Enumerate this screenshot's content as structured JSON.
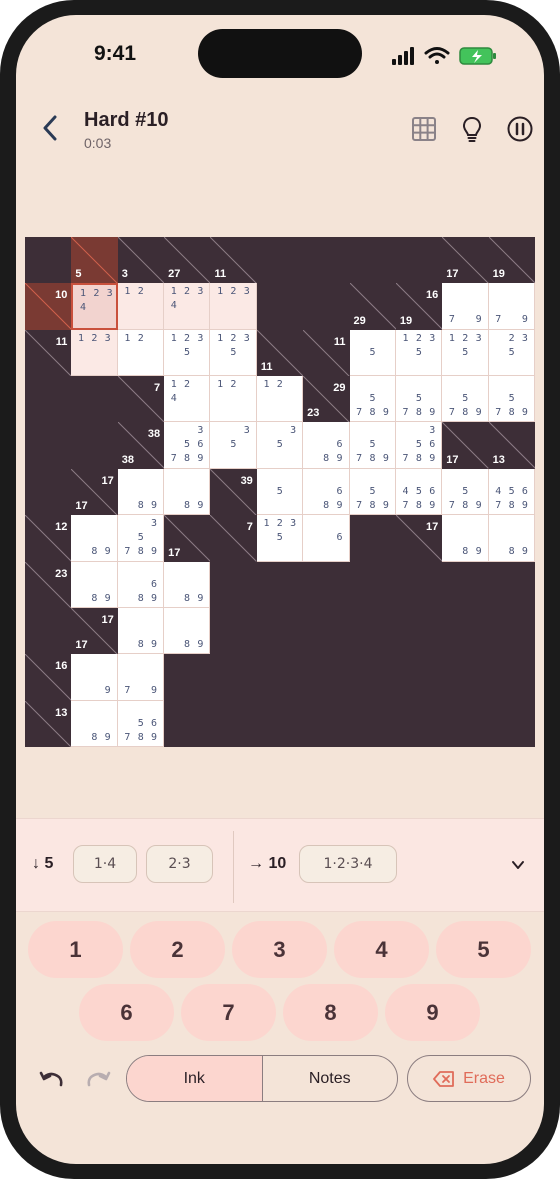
{
  "status": {
    "time": "9:41"
  },
  "header": {
    "title": "Hard #10",
    "timer": "0:03"
  },
  "icons": {
    "back": "chevron-left-icon",
    "grid": "grid-icon",
    "hint": "lightbulb-icon",
    "pause": "pause-icon",
    "undo": "undo-icon",
    "redo": "redo-icon",
    "erase": "erase-icon",
    "expand": "chevron-down-icon"
  },
  "colors": {
    "board": "#3d2e37",
    "cell": "#ffffff",
    "selected_border": "#c9503c",
    "accent": "#fcd6cf",
    "note": "#4a5577"
  },
  "board": {
    "rows": 11,
    "cols": 11,
    "cells": [
      {
        "r": 0,
        "c": 1,
        "down": "5",
        "hl": true
      },
      {
        "r": 0,
        "c": 2,
        "down": "3"
      },
      {
        "r": 0,
        "c": 3,
        "down": "27"
      },
      {
        "r": 0,
        "c": 4,
        "down": "11"
      },
      {
        "r": 0,
        "c": 9,
        "down": "17"
      },
      {
        "r": 0,
        "c": 10,
        "down": "19"
      },
      {
        "r": 1,
        "c": 0,
        "right": "10",
        "hl": true
      },
      {
        "r": 1,
        "c": 1,
        "notes": [
          "1",
          "2",
          "3",
          "4",
          "",
          "",
          "",
          "",
          ""
        ],
        "state": "sel"
      },
      {
        "r": 1,
        "c": 2,
        "notes": [
          "1",
          "2",
          "",
          "",
          "",
          "",
          "",
          "",
          ""
        ],
        "state": "hl"
      },
      {
        "r": 1,
        "c": 3,
        "notes": [
          "1",
          "2",
          "3",
          "4",
          "",
          "",
          "",
          "",
          ""
        ],
        "state": "hl"
      },
      {
        "r": 1,
        "c": 4,
        "notes": [
          "1",
          "2",
          "3",
          "",
          "",
          "",
          "",
          "",
          ""
        ],
        "state": "hl"
      },
      {
        "r": 1,
        "c": 7,
        "down": "29"
      },
      {
        "r": 1,
        "c": 8,
        "down": "19"
      },
      {
        "r": 1,
        "c": 8,
        "right": "16"
      },
      {
        "r": 1,
        "c": 9,
        "notes": [
          "",
          "",
          "",
          "",
          "",
          "",
          "7",
          "",
          "9"
        ]
      },
      {
        "r": 1,
        "c": 10,
        "notes": [
          "",
          "",
          "",
          "",
          "",
          "",
          "7",
          "",
          "9"
        ]
      },
      {
        "r": 2,
        "c": 0,
        "right": "11"
      },
      {
        "r": 2,
        "c": 1,
        "notes": [
          "1",
          "2",
          "3",
          "",
          "",
          "",
          "",
          "",
          ""
        ],
        "state": "hl"
      },
      {
        "r": 2,
        "c": 2,
        "notes": [
          "1",
          "2",
          "",
          "",
          "",
          "",
          "",
          "",
          ""
        ]
      },
      {
        "r": 2,
        "c": 3,
        "notes": [
          "1",
          "2",
          "3",
          "",
          "5",
          "",
          "",
          "",
          ""
        ]
      },
      {
        "r": 2,
        "c": 4,
        "notes": [
          "1",
          "2",
          "3",
          "",
          "5",
          "",
          "",
          "",
          ""
        ]
      },
      {
        "r": 2,
        "c": 5,
        "down": "11"
      },
      {
        "r": 2,
        "c": 6,
        "right": "11"
      },
      {
        "r": 2,
        "c": 7,
        "notes": [
          "",
          "",
          "",
          "",
          "5",
          "",
          "",
          "",
          ""
        ]
      },
      {
        "r": 2,
        "c": 8,
        "notes": [
          "1",
          "2",
          "3",
          "",
          "5",
          "",
          "",
          "",
          ""
        ]
      },
      {
        "r": 2,
        "c": 9,
        "notes": [
          "1",
          "2",
          "3",
          "",
          "5",
          "",
          "",
          "",
          ""
        ]
      },
      {
        "r": 2,
        "c": 10,
        "notes": [
          "",
          "2",
          "3",
          "",
          "5",
          "",
          "",
          "",
          ""
        ]
      },
      {
        "r": 3,
        "c": 2,
        "right": "7"
      },
      {
        "r": 3,
        "c": 3,
        "notes": [
          "1",
          "2",
          "",
          "4",
          "",
          "",
          "",
          "",
          ""
        ]
      },
      {
        "r": 3,
        "c": 4,
        "notes": [
          "1",
          "2",
          "",
          "",
          "",
          "",
          "",
          "",
          ""
        ]
      },
      {
        "r": 3,
        "c": 5,
        "notes": [
          "1",
          "2",
          "",
          "",
          "",
          "",
          "",
          "",
          ""
        ]
      },
      {
        "r": 3,
        "c": 6,
        "down": "23"
      },
      {
        "r": 3,
        "c": 6,
        "right": "29"
      },
      {
        "r": 3,
        "c": 7,
        "notes": [
          "",
          "",
          "",
          "",
          "5",
          "",
          "7",
          "8",
          "9"
        ]
      },
      {
        "r": 3,
        "c": 8,
        "notes": [
          "",
          "",
          "",
          "",
          "5",
          "",
          "7",
          "8",
          "9"
        ]
      },
      {
        "r": 3,
        "c": 9,
        "notes": [
          "",
          "",
          "",
          "",
          "5",
          "",
          "7",
          "8",
          "9"
        ]
      },
      {
        "r": 3,
        "c": 10,
        "notes": [
          "",
          "",
          "",
          "",
          "5",
          "",
          "7",
          "8",
          "9"
        ]
      },
      {
        "r": 4,
        "c": 2,
        "down": "38"
      },
      {
        "r": 4,
        "c": 2,
        "right": "38"
      },
      {
        "r": 4,
        "c": 3,
        "notes": [
          "",
          "",
          "3",
          "",
          "5",
          "6",
          "7",
          "8",
          "9"
        ]
      },
      {
        "r": 4,
        "c": 4,
        "notes": [
          "",
          "",
          "3",
          "",
          "5",
          "",
          "",
          "",
          ""
        ]
      },
      {
        "r": 4,
        "c": 5,
        "notes": [
          "",
          "",
          "3",
          "",
          "5",
          "",
          "",
          "",
          ""
        ]
      },
      {
        "r": 4,
        "c": 6,
        "notes": [
          "",
          "",
          "",
          "",
          "",
          "6",
          "",
          "8",
          "9"
        ]
      },
      {
        "r": 4,
        "c": 7,
        "notes": [
          "",
          "",
          "",
          "",
          "5",
          "",
          "7",
          "8",
          "9"
        ]
      },
      {
        "r": 4,
        "c": 8,
        "notes": [
          "",
          "",
          "3",
          "",
          "5",
          "6",
          "7",
          "8",
          "9"
        ]
      },
      {
        "r": 4,
        "c": 9,
        "down": "17"
      },
      {
        "r": 4,
        "c": 10,
        "down": "13"
      },
      {
        "r": 5,
        "c": 1,
        "down": "17"
      },
      {
        "r": 5,
        "c": 1,
        "right": "17"
      },
      {
        "r": 5,
        "c": 2,
        "notes": [
          "",
          "",
          "",
          "",
          "",
          "",
          "",
          "8",
          "9"
        ]
      },
      {
        "r": 5,
        "c": 3,
        "notes": [
          "",
          "",
          "",
          "",
          "",
          "",
          "",
          "8",
          "9"
        ]
      },
      {
        "r": 5,
        "c": 4,
        "right": "39"
      },
      {
        "r": 5,
        "c": 5,
        "notes": [
          "",
          "",
          "",
          "",
          "5",
          "",
          "",
          "",
          ""
        ]
      },
      {
        "r": 5,
        "c": 6,
        "notes": [
          "",
          "",
          "",
          "",
          "",
          "6",
          "",
          "8",
          "9"
        ]
      },
      {
        "r": 5,
        "c": 7,
        "notes": [
          "",
          "",
          "",
          "",
          "5",
          "",
          "7",
          "8",
          "9"
        ]
      },
      {
        "r": 5,
        "c": 8,
        "notes": [
          "",
          "",
          "",
          "4",
          "5",
          "6",
          "7",
          "8",
          "9"
        ]
      },
      {
        "r": 5,
        "c": 9,
        "notes": [
          "",
          "",
          "",
          "",
          "5",
          "",
          "7",
          "8",
          "9"
        ]
      },
      {
        "r": 5,
        "c": 10,
        "notes": [
          "",
          "",
          "",
          "4",
          "5",
          "6",
          "7",
          "8",
          "9"
        ]
      },
      {
        "r": 6,
        "c": 0,
        "right": "12"
      },
      {
        "r": 6,
        "c": 1,
        "notes": [
          "",
          "",
          "",
          "",
          "",
          "",
          "",
          "8",
          "9"
        ]
      },
      {
        "r": 6,
        "c": 2,
        "notes": [
          "",
          "",
          "3",
          "",
          "5",
          "",
          "7",
          "8",
          "9"
        ]
      },
      {
        "r": 6,
        "c": 3,
        "down": "17"
      },
      {
        "r": 6,
        "c": 4,
        "right": "7"
      },
      {
        "r": 6,
        "c": 5,
        "notes": [
          "1",
          "2",
          "3",
          "",
          "5",
          "",
          "",
          "",
          ""
        ]
      },
      {
        "r": 6,
        "c": 6,
        "notes": [
          "",
          "",
          "",
          "",
          "",
          "6",
          "",
          "",
          ""
        ]
      },
      {
        "r": 6,
        "c": 8,
        "right": "17"
      },
      {
        "r": 6,
        "c": 9,
        "notes": [
          "",
          "",
          "",
          "",
          "",
          "",
          "",
          "8",
          "9"
        ]
      },
      {
        "r": 6,
        "c": 10,
        "notes": [
          "",
          "",
          "",
          "",
          "",
          "",
          "",
          "8",
          "9"
        ]
      },
      {
        "r": 7,
        "c": 0,
        "right": "23"
      },
      {
        "r": 7,
        "c": 1,
        "notes": [
          "",
          "",
          "",
          "",
          "",
          "",
          "",
          "8",
          "9"
        ]
      },
      {
        "r": 7,
        "c": 2,
        "notes": [
          "",
          "",
          "",
          "",
          "",
          "6",
          "",
          "8",
          "9"
        ]
      },
      {
        "r": 7,
        "c": 3,
        "notes": [
          "",
          "",
          "",
          "",
          "",
          "",
          "",
          "8",
          "9"
        ]
      },
      {
        "r": 8,
        "c": 1,
        "down": "17"
      },
      {
        "r": 8,
        "c": 1,
        "right": "17"
      },
      {
        "r": 8,
        "c": 2,
        "notes": [
          "",
          "",
          "",
          "",
          "",
          "",
          "",
          "8",
          "9"
        ]
      },
      {
        "r": 8,
        "c": 3,
        "notes": [
          "",
          "",
          "",
          "",
          "",
          "",
          "",
          "8",
          "9"
        ]
      },
      {
        "r": 9,
        "c": 0,
        "right": "16"
      },
      {
        "r": 9,
        "c": 1,
        "notes": [
          "",
          "",
          "",
          "",
          "",
          "",
          "",
          "",
          "9"
        ]
      },
      {
        "r": 9,
        "c": 2,
        "notes": [
          "",
          "",
          "",
          "",
          "",
          "",
          "7",
          "",
          "9"
        ]
      },
      {
        "r": 10,
        "c": 0,
        "right": "13"
      },
      {
        "r": 10,
        "c": 1,
        "notes": [
          "",
          "",
          "",
          "",
          "",
          "",
          "",
          "8",
          "9"
        ]
      },
      {
        "r": 10,
        "c": 2,
        "notes": [
          "",
          "",
          "",
          "",
          "5",
          "6",
          "7",
          "8",
          "9"
        ]
      }
    ]
  },
  "clue_bar": {
    "down_label": "5",
    "down_combos": [
      "1·4",
      "2·3"
    ],
    "right_label": "10",
    "right_combos": [
      "1·2·3·4"
    ]
  },
  "keypad": [
    "1",
    "2",
    "3",
    "4",
    "5",
    "6",
    "7",
    "8",
    "9"
  ],
  "controls": {
    "ink": "Ink",
    "notes": "Notes",
    "erase": "Erase"
  }
}
